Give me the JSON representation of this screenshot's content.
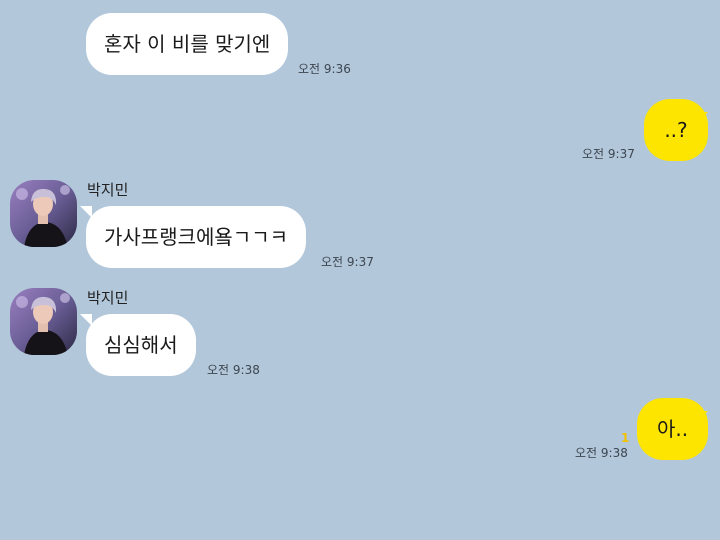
{
  "messages": [
    {
      "text": "혼자 이 비를 맞기엔",
      "time": "오전 9:36"
    },
    {
      "text": "..?",
      "time": "오전 9:37"
    },
    {
      "sender": "박지민",
      "text": "가사프랭크에욬ㄱㄱㅋ",
      "time": "오전 9:37"
    },
    {
      "sender": "박지민",
      "text": "심심해서",
      "time": "오전 9:38"
    },
    {
      "text": "아..",
      "time": "오전 9:38",
      "unread": "1"
    }
  ],
  "colors": {
    "background": "#b2c7da",
    "incoming_bubble": "#ffffff",
    "outgoing_bubble": "#fee500",
    "unread_count": "#f2c200"
  }
}
